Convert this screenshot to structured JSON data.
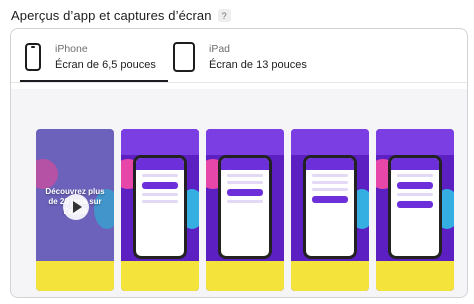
{
  "section": {
    "title": "Aperçus d’app et captures d’écran",
    "help_icon_symbol": "?",
    "help_icon": "question-mark-icon"
  },
  "tabs": [
    {
      "name": "iPhone",
      "size": "Écran de 6,5 pouces",
      "icon": "iphone-icon",
      "selected": true
    },
    {
      "name": "iPad",
      "size": "Écran de 13 pouces",
      "icon": "ipad-icon",
      "selected": false
    }
  ],
  "screenshots": {
    "video": {
      "text": "Découvrez plus de 20 jeux sur l’appli",
      "play_icon": "play-icon"
    },
    "items": [
      {
        "kind": "screenshot"
      },
      {
        "kind": "screenshot"
      },
      {
        "kind": "screenshot"
      },
      {
        "kind": "screenshot"
      }
    ],
    "colors": {
      "purple": "#5b1fc2",
      "accent_purple": "#7a3ee3",
      "yellow": "#f4e33a",
      "pink": "#ff4fa3",
      "cyan": "#2fc9e6",
      "orange": "#ff9a3c"
    }
  }
}
